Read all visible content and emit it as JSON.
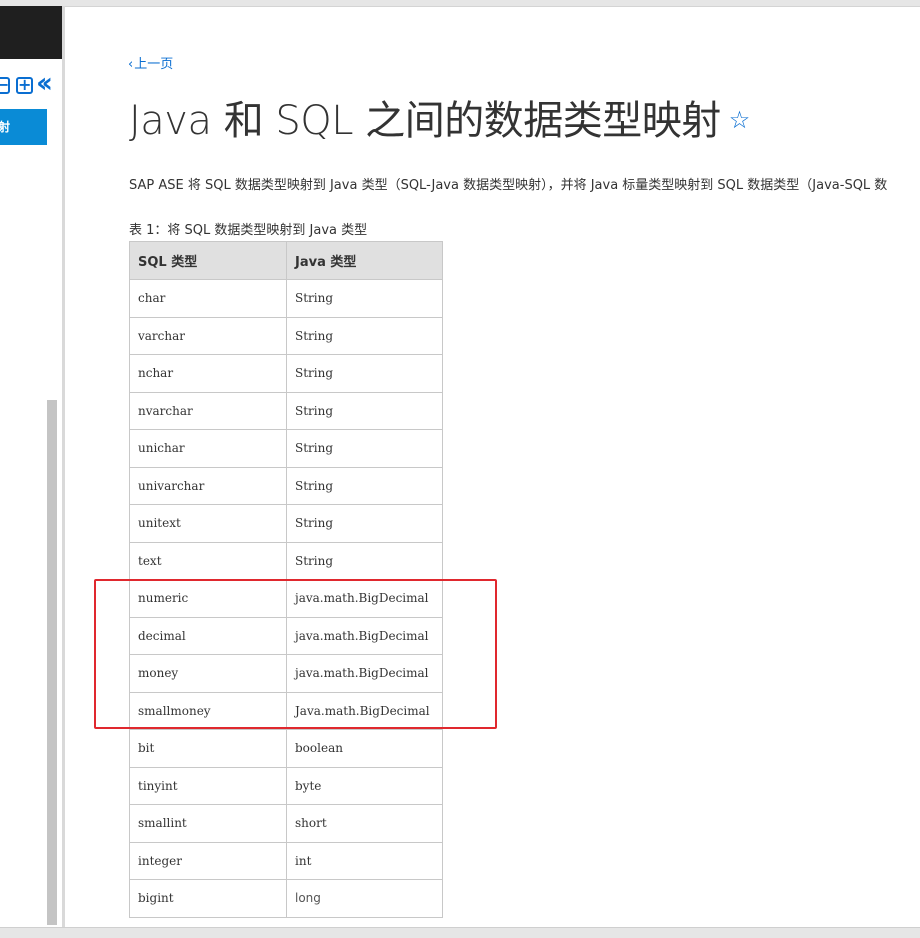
{
  "nav": {
    "collapse_icon": "minus-square-icon",
    "expand_icon": "plus-square-icon",
    "hide_icon": "double-chevron-left-icon",
    "active_item": "映射"
  },
  "page": {
    "prev_link": "上一页",
    "title": "Java 和 SQL 之间的数据类型映射",
    "favorite_icon": "star-outline-icon",
    "intro": "SAP ASE 将 SQL 数据类型映射到 Java 类型（SQL-Java 数据类型映射），并将 Java 标量类型映射到 SQL 数据类型（Java-SQL 数",
    "caption": "表 1：将 SQL 数据类型映射到 Java 类型"
  },
  "table": {
    "headers": [
      "SQL 类型",
      "Java 类型"
    ],
    "rows": [
      [
        "char",
        "String"
      ],
      [
        "varchar",
        "String"
      ],
      [
        "nchar",
        "String"
      ],
      [
        "nvarchar",
        "String"
      ],
      [
        "unichar",
        "String"
      ],
      [
        "univarchar",
        "String"
      ],
      [
        "unitext",
        "String"
      ],
      [
        "text",
        "String"
      ],
      [
        "numeric",
        "java.math.BigDecimal"
      ],
      [
        "decimal",
        "java.math.BigDecimal"
      ],
      [
        "money",
        "java.math.BigDecimal"
      ],
      [
        "smallmoney",
        "Java.math.BigDecimal"
      ],
      [
        "bit",
        "boolean"
      ],
      [
        "tinyint",
        "byte"
      ],
      [
        "smallint",
        "short"
      ],
      [
        "integer",
        "int"
      ],
      [
        "bigint",
        "long"
      ]
    ]
  },
  "colors": {
    "accent": "#0a6ed1",
    "highlight": "#e0282e",
    "header_bg": "#e0e0e0"
  }
}
